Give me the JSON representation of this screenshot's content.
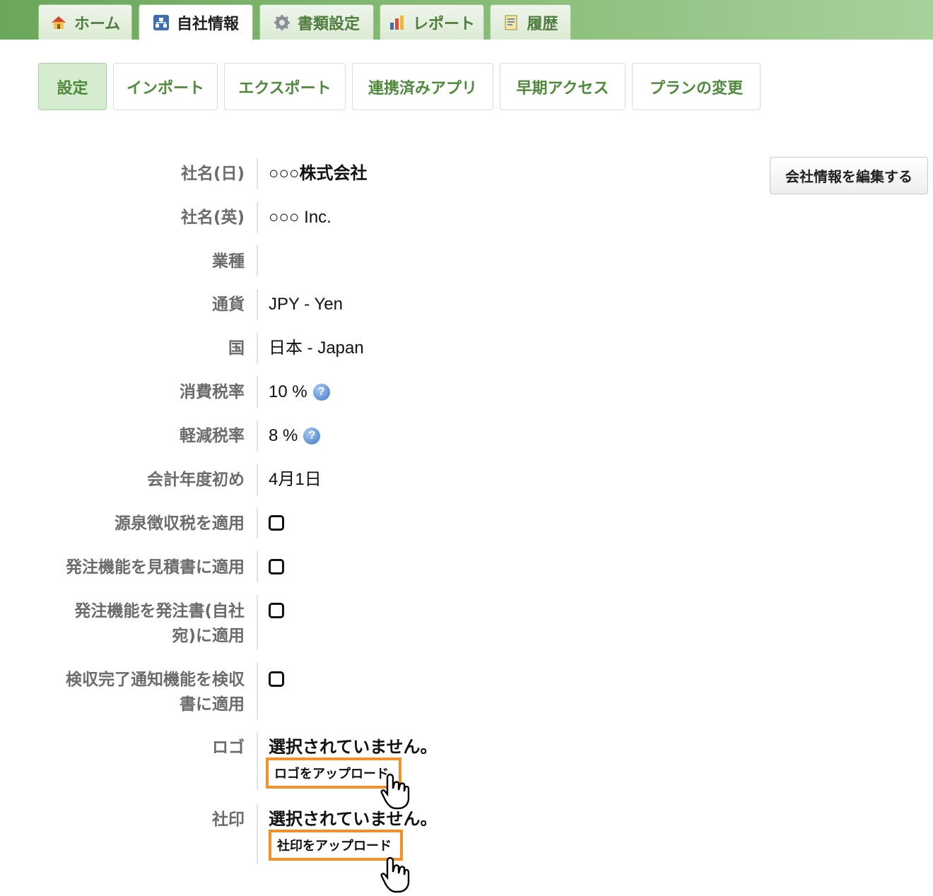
{
  "top_tabs": [
    {
      "label": "ホーム",
      "icon": "home-icon"
    },
    {
      "label": "自社情報",
      "icon": "org-chart-icon"
    },
    {
      "label": "書類設定",
      "icon": "gear-icon"
    },
    {
      "label": "レポート",
      "icon": "bar-chart-icon"
    },
    {
      "label": "履歴",
      "icon": "document-icon"
    }
  ],
  "sub_tabs": [
    "設定",
    "インポート",
    "エクスポート",
    "連携済みアプリ",
    "早期アクセス",
    "プランの変更"
  ],
  "edit_button": "会社情報を編集する",
  "fields": {
    "name_ja": {
      "label": "社名(日)",
      "value": "○○○株式会社"
    },
    "name_en": {
      "label": "社名(英)",
      "value": "○○○ Inc."
    },
    "industry": {
      "label": "業種",
      "value": ""
    },
    "currency": {
      "label": "通貨",
      "value": "JPY - Yen"
    },
    "country": {
      "label": "国",
      "value": "日本 - Japan"
    },
    "tax": {
      "label": "消費税率",
      "value": "10 %"
    },
    "reduced_tax": {
      "label": "軽減税率",
      "value": "8 %"
    },
    "fiscal_start": {
      "label": "会計年度初め",
      "value": "4月1日"
    },
    "withholding": {
      "label": "源泉徴収税を適用"
    },
    "order_quote": {
      "label": "発注機能を見積書に適用"
    },
    "order_po_line1": "発注機能を発注書(自社",
    "order_po_line2": "宛)に適用",
    "inspection_line1": "検収完了通知機能を検収",
    "inspection_line2": "書に適用",
    "logo": {
      "label": "ロゴ",
      "status": "選択されていません。",
      "button": "ロゴをアップロード"
    },
    "seal": {
      "label": "社印",
      "status": "選択されていません。",
      "button": "社印をアップロード"
    }
  },
  "help_icon_glyph": "?",
  "colors": {
    "accent_green": "#4f8a3c",
    "highlight_orange": "#f0912b"
  }
}
